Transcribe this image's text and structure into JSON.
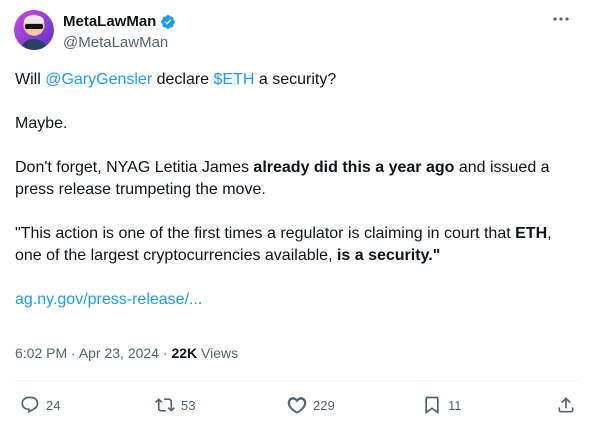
{
  "author": {
    "name": "MetaLawMan",
    "handle": "@MetaLawMan",
    "verified": true
  },
  "tweet": {
    "line1_prefix": "Will ",
    "line1_mention": "@GaryGensler",
    "line1_middle": " declare ",
    "line1_cashtag": "$ETH",
    "line1_suffix": " a security?",
    "p2": "Maybe.",
    "p3_prefix": "Don't forget, NYAG Letitia James ",
    "p3_bold": "already did this a year ago",
    "p3_suffix": " and issued a press release trumpeting the move.",
    "p4_prefix": "\"This action is one of the first times a regulator is claiming in court that ",
    "p4_bold1": "ETH",
    "p4_middle": ", one of the largest cryptocurrencies available, ",
    "p4_bold2": "is a security.\"",
    "link": "ag.ny.gov/press-release/..."
  },
  "meta": {
    "time": "6:02 PM",
    "sep1": " · ",
    "date": "Apr 23, 2024",
    "sep2": " · ",
    "views_count": "22K",
    "views_label": " Views"
  },
  "actions": {
    "replies": "24",
    "reposts": "53",
    "likes": "229",
    "bookmarks": "11"
  },
  "colors": {
    "accent": "#1d9bf0",
    "muted": "#536471",
    "text": "#0f1419"
  }
}
